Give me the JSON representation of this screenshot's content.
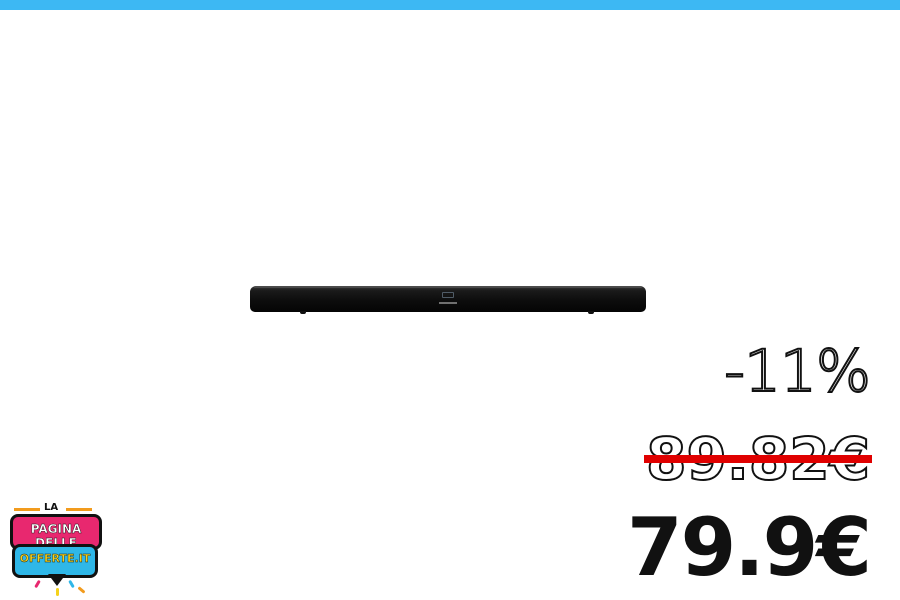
{
  "header": {
    "accent_color": "#3db8f3"
  },
  "product": {
    "image": "soundbar"
  },
  "pricing": {
    "discount": "-11%",
    "old_price": "89.82€",
    "new_price": "79.9€",
    "strike_color": "#e00000"
  },
  "logo": {
    "line1": "LA",
    "line2": "PAGINA DELLE",
    "line3": "OFFERTE.IT",
    "colors": {
      "pink": "#e8286f",
      "blue": "#2fb7e8",
      "yellow": "#f5d21b",
      "orange": "#f29b1d"
    }
  }
}
